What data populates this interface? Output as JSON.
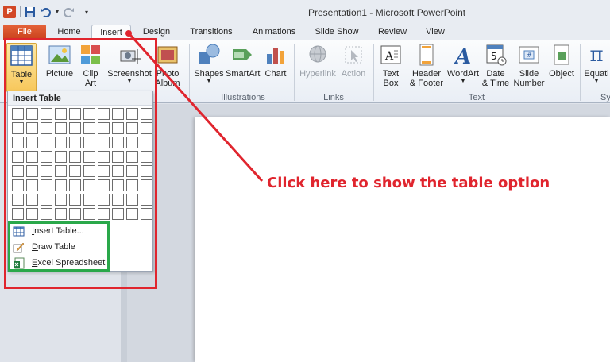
{
  "window": {
    "title": "Presentation1 - Microsoft PowerPoint"
  },
  "app": {
    "logo_letter": "P"
  },
  "tabs": [
    {
      "label": "File"
    },
    {
      "label": "Home"
    },
    {
      "label": "Insert",
      "active": true
    },
    {
      "label": "Design"
    },
    {
      "label": "Transitions"
    },
    {
      "label": "Animations"
    },
    {
      "label": "Slide Show"
    },
    {
      "label": "Review"
    },
    {
      "label": "View"
    }
  ],
  "ribbon": {
    "table": {
      "label": "Table"
    },
    "picture": {
      "label": "Picture"
    },
    "clip_art": {
      "line1": "Clip",
      "line2": "Art"
    },
    "screenshot": {
      "label": "Screenshot"
    },
    "photo_album": {
      "line1": "Photo",
      "line2": "Album"
    },
    "shapes": {
      "label": "Shapes"
    },
    "smartart": {
      "label": "SmartArt"
    },
    "chart": {
      "label": "Chart"
    },
    "hyperlink": {
      "label": "Hyperlink"
    },
    "action": {
      "label": "Action"
    },
    "text_box": {
      "line1": "Text",
      "line2": "Box"
    },
    "header_footer": {
      "line1": "Header",
      "line2": "& Footer"
    },
    "wordart": {
      "label": "WordArt"
    },
    "date_time": {
      "line1": "Date",
      "line2": "& Time"
    },
    "slide_number": {
      "line1": "Slide",
      "line2": "Number"
    },
    "object": {
      "label": "Object"
    },
    "equation": {
      "label": "Equati"
    },
    "groups": {
      "illustrations": "Illustrations",
      "links": "Links",
      "text": "Text",
      "symbols": "Sy"
    }
  },
  "dropdown": {
    "header": "Insert Table",
    "grid": {
      "rows": 8,
      "cols": 10
    },
    "items": [
      {
        "label": "Insert Table...",
        "mnemonic": "I",
        "rest": "nsert Table..."
      },
      {
        "label": "Draw Table",
        "mnemonic": "D",
        "rest": "raw Table"
      },
      {
        "label": "Excel Spreadsheet",
        "mnemonic": "E",
        "rest": "xcel Spreadsheet"
      }
    ]
  },
  "annotation": {
    "text": "Click here to show the table option",
    "color": "#e0252e",
    "highlight_green": "#2aa84a"
  },
  "colors": {
    "file_tab": "#d24726",
    "accent_blue": "#2a5aa0"
  }
}
